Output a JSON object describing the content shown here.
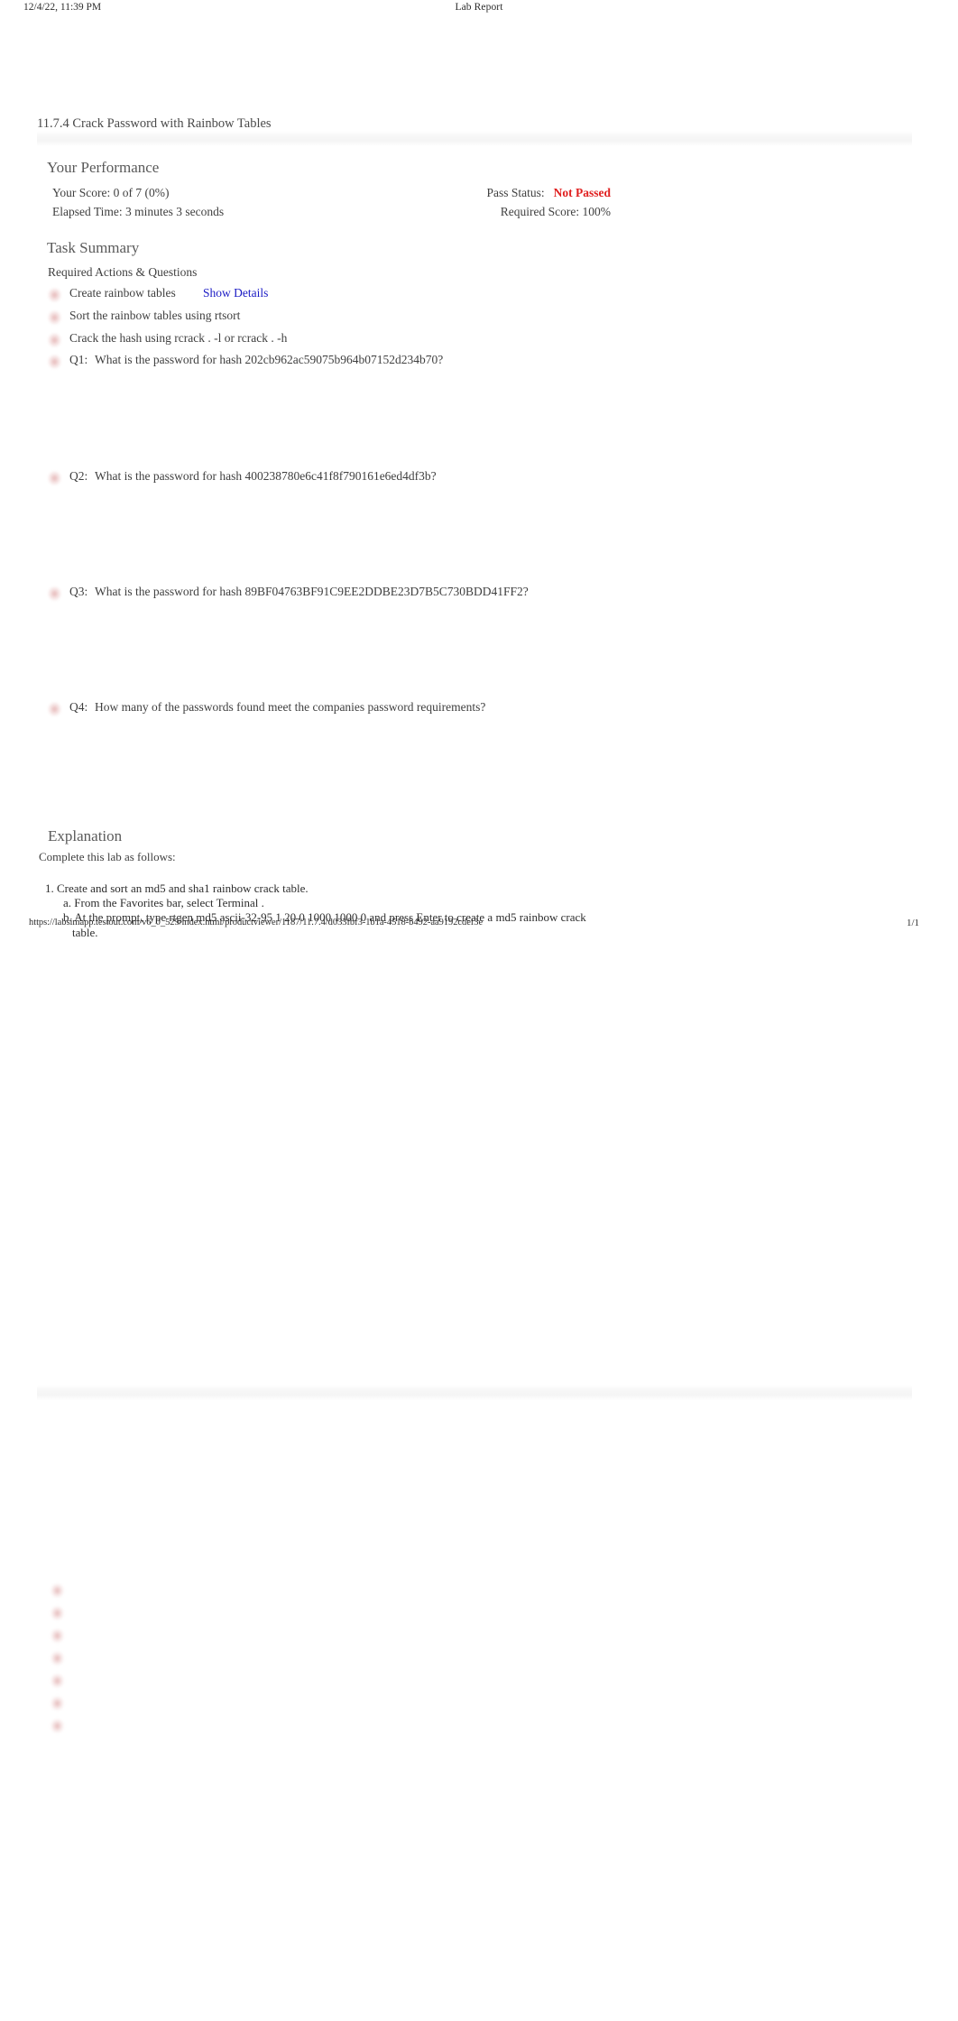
{
  "print_header": {
    "date": "12/4/22, 11:39 PM",
    "title": "Lab Report"
  },
  "report": {
    "title": "11.7.4 Crack Password with Rainbow Tables"
  },
  "performance": {
    "heading": "Your Performance",
    "score_line": "Your Score: 0 of 7 (0%)",
    "elapsed_line": "Elapsed Time: 3 minutes 3 seconds",
    "pass_status_label": "Pass Status:",
    "pass_status_value": "Not Passed",
    "pass_status_color": "#e02020",
    "required_score_line": "Required Score: 100%"
  },
  "task_summary": {
    "heading": "Task Summary",
    "subheading": "Required Actions & Questions",
    "show_details_label": "Show Details",
    "items": [
      {
        "status": "incorrect",
        "prefix": "",
        "label": "Create rainbow tables",
        "has_details_link": true
      },
      {
        "status": "incorrect",
        "prefix": "",
        "label": "Sort the rainbow tables using rtsort",
        "has_details_link": false
      },
      {
        "status": "incorrect",
        "prefix": "",
        "label": "Crack the hash using rcrack . -l or rcrack . -h",
        "has_details_link": false
      },
      {
        "status": "incorrect",
        "prefix": "Q1:",
        "label": "What is the password for hash 202cb962ac59075b964b07152d234b70?",
        "has_details_link": false
      },
      {
        "status": "incorrect",
        "prefix": "Q2:",
        "label": "What is the password for hash 400238780e6c41f8f790161e6ed4df3b?",
        "has_details_link": false
      },
      {
        "status": "incorrect",
        "prefix": "Q3:",
        "label": "What is the password for hash 89BF04763BF91C9EE2DDBE23D7B5C730BDD41FF2?",
        "has_details_link": false
      },
      {
        "status": "incorrect",
        "prefix": "Q4:",
        "label": "How many of the passwords found meet the companies password requirements?",
        "has_details_link": false
      }
    ]
  },
  "explanation": {
    "heading": "Explanation",
    "intro": "Complete this lab as follows:",
    "step_1": "1. Create and sort an md5 and sha1 rainbow crack table.",
    "step_1a": "a. From the Favorites bar, select        Terminal   .",
    "step_1b": "b. At the prompt, type     rtgen md5 ascii-32-95 1 20 0 1000 1000 0        and press    Enter   to create a md5 rainbow crack",
    "step_1b_cont": "table."
  },
  "footer": {
    "url": "https://labsimapp.testout.com/v6_0_525/index.html/productviewer/1187/11.7.4/d033fbf3-1b1a-4518-b492-aa9192cdef3e",
    "page_number": "1/1"
  }
}
